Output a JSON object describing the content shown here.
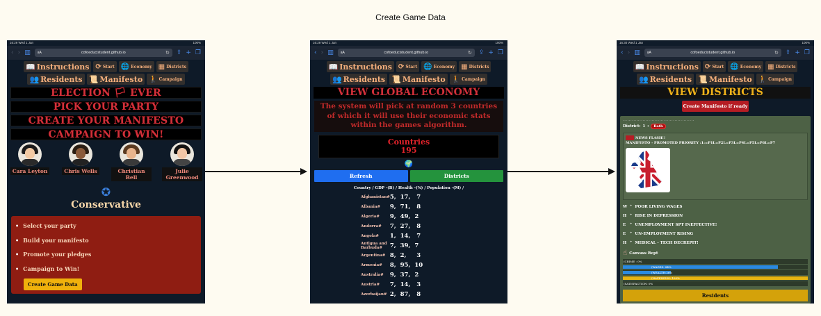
{
  "title": "Create Game Data",
  "status_bar": {
    "time1": "16:29",
    "time2": "16:29",
    "time3": "16:30",
    "date": "Wed 1 Jan",
    "battery": "100%"
  },
  "browser": {
    "aa": "aA",
    "url": "cofoeducistudent.github.io"
  },
  "nav": {
    "instructions": "Instructions",
    "start": "Start",
    "economy": "Economy",
    "districts": "Districts",
    "residents": "Residents",
    "manifesto": "Manifesto",
    "campaign": "Campaign"
  },
  "screen1": {
    "banners": [
      "ELECTION 🏳 EVER",
      "PICK YOUR PARTY",
      "CREATE YOUR MANIFESTO",
      "CAMPAIGN TO WIN!"
    ],
    "characters": [
      "Cara Leyton",
      "Chris Wells",
      "Christian Bell",
      "Julie Greenwood"
    ],
    "party": "Conservative",
    "steps": [
      "Select your party",
      "Build your manifesto",
      "Promote your pledges",
      "Campaign to Win!"
    ],
    "create_button": "Create Game Data"
  },
  "screen2": {
    "heading": "VIEW GLOBAL ECONOMY",
    "description": "The system will pick at random 3 countries of which it will use their economic stats within the games algorithm.",
    "countries_label": "Countries",
    "countries_count": "195",
    "refresh": "Refresh",
    "districts": "Districts",
    "columns": "Country / GDP -(B) / Health -(%) / Population -(M) /",
    "rows": [
      {
        "name": "Afghanistan#",
        "v": "5,  17,   7"
      },
      {
        "name": "Albania#",
        "v": "9,  71,   8"
      },
      {
        "name": "Algeria#",
        "v": "9,  49,  2"
      },
      {
        "name": "Andorra#",
        "v": "7,  27,   8"
      },
      {
        "name": "Angola#",
        "v": "1,  14,   7"
      },
      {
        "name": "Antigua and Barbuda#",
        "v": "7,  39,  7"
      },
      {
        "name": "Argentina#",
        "v": "8,  2,     3"
      },
      {
        "name": "Armenia#",
        "v": "8,  95,  10"
      },
      {
        "name": "Australia#",
        "v": "9,  37,  2"
      },
      {
        "name": "Austria#",
        "v": "7,  14,   3"
      },
      {
        "name": "Azerbaijan#",
        "v": "2,  87,   8"
      }
    ]
  },
  "screen3": {
    "heading": "VIEW DISTRICTS",
    "manifesto_button": "Create Manifesto if ready",
    "district_label": "District:",
    "district_num": "1",
    "district_sep": ":",
    "district_name": "Bath",
    "news_flash": "NEWS FLASH!!",
    "priority": "MANIFESTO - PROMOTED PRIORITY :1:=P1L=P2L=P3L=P4L=P5L=P6L=P7",
    "issues": [
      {
        "letter": "W",
        "text": "POOR LIVING WAGES"
      },
      {
        "letter": "H",
        "text": "RISE IN DEPRESSION"
      },
      {
        "letter": "E",
        "text": "UNEMPLOYMENT SPT INEFFECTIVE!"
      },
      {
        "letter": "E",
        "text": "UN-EMPLOYMENT RISING"
      },
      {
        "letter": "H",
        "text": "MEDICAL - TECH DECREPIT!"
      }
    ],
    "canvass": "Canvass Rept",
    "stats": [
      {
        "label": "(CRIME : 0%",
        "fill": 0,
        "color": "#2b8ae0"
      },
      {
        "label": "(WAGES: 84%",
        "fill": 0.84,
        "color": "#2b8ae0"
      },
      {
        "label": "(WEALTH:26%",
        "fill": 0.26,
        "color": "#2b8ae0"
      },
      {
        "label": "(HAPPINESS: 100%",
        "fill": 1.0,
        "color": "#e6b412"
      },
      {
        "label": "(SATISFACTION: 0%",
        "fill": 0,
        "color": "#2b8ae0"
      }
    ],
    "residents_button": "Residents"
  },
  "colors": {
    "background": "#fefbf1",
    "screen": "#0e1a28",
    "refresh": "#1f6ef0",
    "districts": "#24933d",
    "party_box": "#8f1d12"
  }
}
